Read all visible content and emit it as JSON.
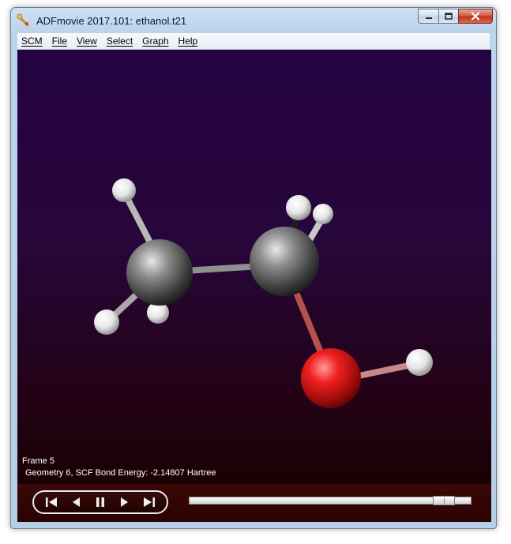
{
  "window": {
    "title": "ADFmovie 2017.101: ethanol.t21",
    "controls": [
      "minimize-icon",
      "maximize-icon",
      "close-icon"
    ]
  },
  "menu": {
    "items": [
      {
        "label": "SCM"
      },
      {
        "label": "File"
      },
      {
        "label": "View"
      },
      {
        "label": "Select"
      },
      {
        "label": "Graph"
      },
      {
        "label": "Help"
      }
    ]
  },
  "viewer": {
    "frame_label": "Frame 5",
    "energy_label": "Geometry 6, SCF Bond Energy: -2.14807 Hartree",
    "background_top": "#240342",
    "background_bottom": "#1a0104",
    "atom_colors": {
      "carbon": "#8a8a8a",
      "hydrogen": "#ffffff",
      "oxygen": "#e01818"
    }
  },
  "playback": {
    "buttons": [
      "first-frame-icon",
      "previous-frame-icon",
      "pause-icon",
      "next-frame-icon",
      "last-frame-icon"
    ],
    "progress_fraction": 0.94
  }
}
